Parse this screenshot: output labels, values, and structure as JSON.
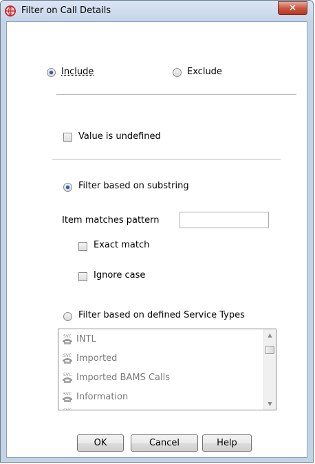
{
  "window": {
    "title": "Filter on Call Details",
    "close_glyph": "✕",
    "app_icon": "globe-icon"
  },
  "mode": {
    "include_label": "Include",
    "exclude_label": "Exclude",
    "selected": "include"
  },
  "undefined_option": {
    "label": "Value is undefined",
    "checked": false
  },
  "substring": {
    "label": "Filter based on substring",
    "selected": true,
    "pattern_label": "Item matches pattern",
    "pattern_value": "",
    "exact_match_label": "Exact match",
    "exact_match_checked": false,
    "ignore_case_label": "Ignore case",
    "ignore_case_checked": false
  },
  "service_types": {
    "label": "Filter based on defined Service Types",
    "selected": false,
    "icon": "svc-telephone-icon",
    "items": [
      "INTL",
      "Imported",
      "Imported BAMS Calls",
      "Information"
    ]
  },
  "buttons": {
    "ok": "OK",
    "cancel": "Cancel",
    "help": "Help"
  }
}
